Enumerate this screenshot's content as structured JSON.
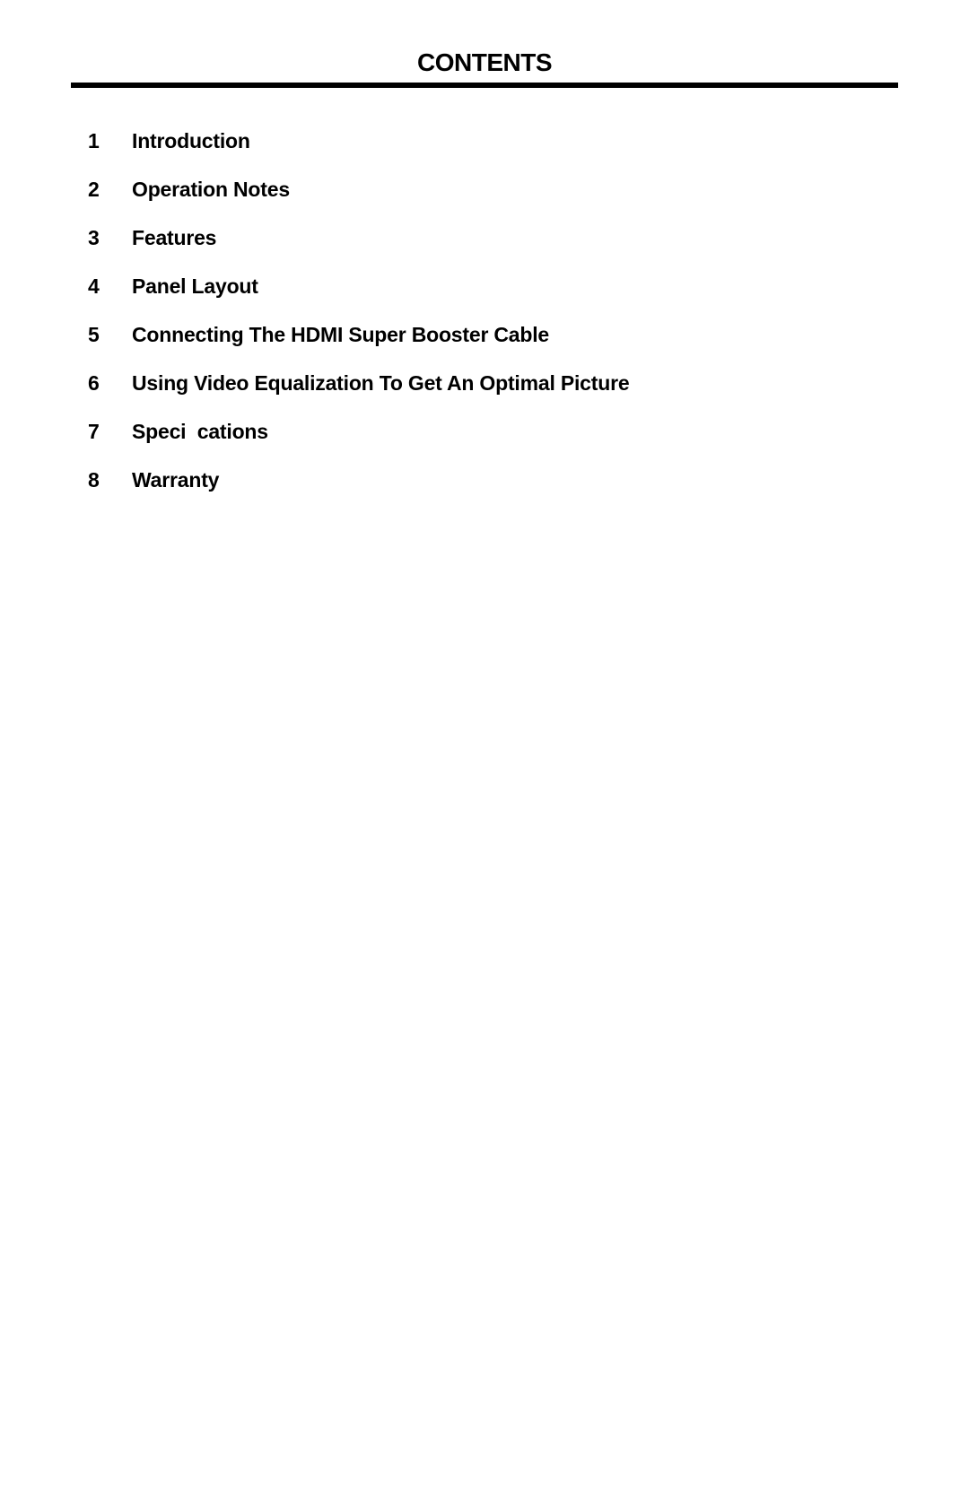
{
  "document": {
    "title": "CONTENTS",
    "toc": [
      {
        "number": "1",
        "label": "Introduction"
      },
      {
        "number": "2",
        "label": "Operation Notes"
      },
      {
        "number": "3",
        "label": "Features"
      },
      {
        "number": "4",
        "label": "Panel Layout"
      },
      {
        "number": "5",
        "label": "Connecting The HDMI Super Booster Cable"
      },
      {
        "number": "6",
        "label": "Using Video Equalization To Get An Optimal Picture"
      },
      {
        "number": "7",
        "label": "Speci  cations"
      },
      {
        "number": "8",
        "label": "Warranty"
      }
    ]
  }
}
